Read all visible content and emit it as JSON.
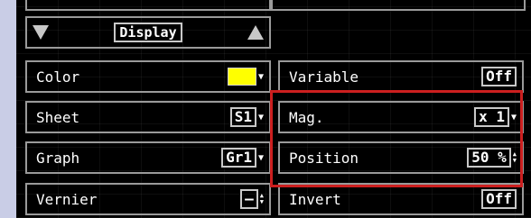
{
  "display": {
    "label": "Display"
  },
  "left_rows": [
    {
      "label": "Color",
      "value": ""
    },
    {
      "label": "Sheet",
      "value": "S1"
    },
    {
      "label": "Graph",
      "value": "Gr1"
    },
    {
      "label": "Vernier",
      "value": "—"
    }
  ],
  "right_rows": [
    {
      "label": "Variable",
      "value": "Off"
    },
    {
      "label": "Mag.",
      "value": "x 1"
    },
    {
      "label": "Position",
      "value": "50 %"
    },
    {
      "label": "Invert",
      "value": "Off"
    }
  ],
  "colors": {
    "selected_color": "#ffff00",
    "highlight": "#cc1f1f",
    "panel_bg": "#000000",
    "margin_bg": "#c9cde6"
  },
  "icons": {
    "scroll_down": "triangle-down-icon",
    "scroll_up": "triangle-up-icon",
    "spinner": "spinner-arrows-icon",
    "dropdown": "dropdown-arrow-icon"
  }
}
